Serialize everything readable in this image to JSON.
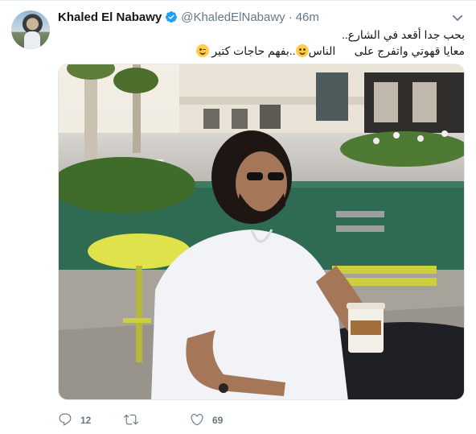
{
  "tweet": {
    "author_name": "Khaled El Nabawy",
    "handle": "@KhaledElNabawy",
    "separator": "·",
    "time": "46m",
    "text_line1": "بحب جدا أقعد في الشارع..",
    "text_line2_a": "معايا قهوتي واتفرج على",
    "text_line2_b": "الناس",
    "text_line2_c": "..بفهم حاجات كتير",
    "reply_count": "12",
    "retweet_count": "",
    "like_count": "69"
  },
  "icons": {
    "verified": "verified-badge-icon",
    "more": "chevron-down-icon",
    "reply": "reply-icon",
    "retweet": "retweet-icon",
    "like": "heart-icon",
    "emoji_1": "smiling-face-emoji",
    "emoji_2": "winking-face-emoji"
  },
  "colors": {
    "name": "#14171a",
    "meta": "#657786",
    "verified": "#1da1f2",
    "border": "#e1e8ed"
  }
}
